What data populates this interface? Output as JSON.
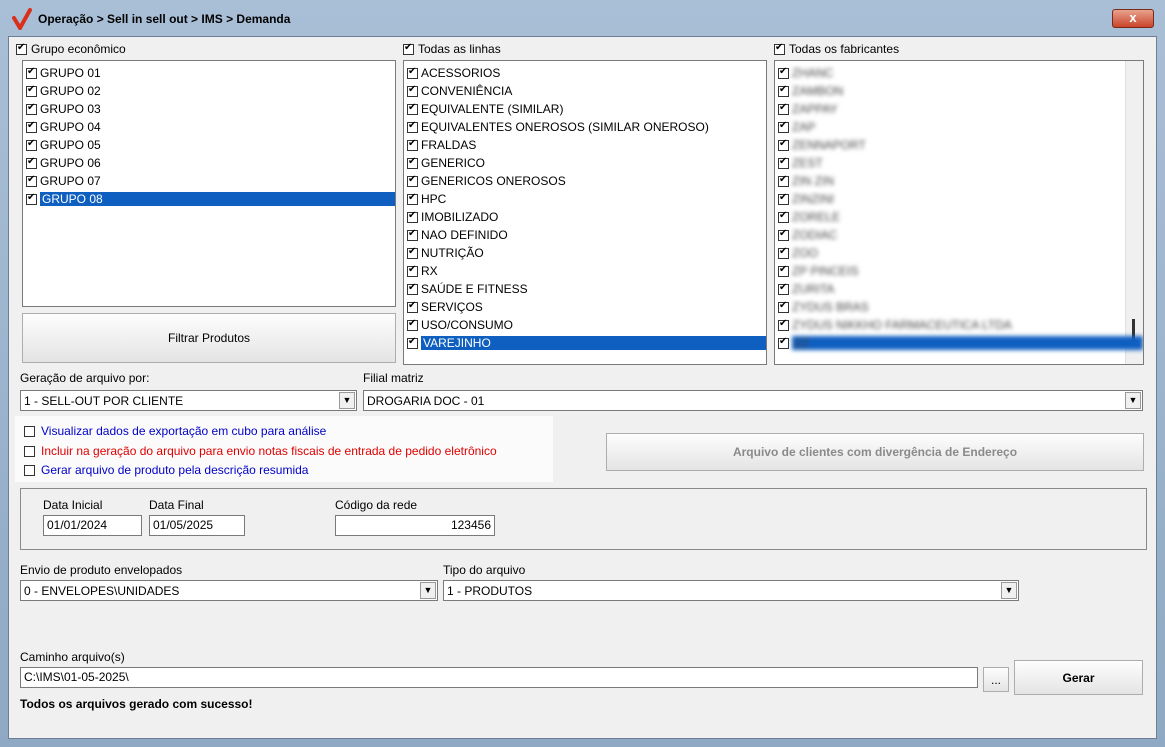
{
  "window": {
    "title": "Operação > Sell in sell out > IMS > Demanda",
    "close": "x"
  },
  "groups": {
    "header": "Grupo econômico",
    "items": [
      {
        "label": "GRUPO 01",
        "checked": true
      },
      {
        "label": "GRUPO 02",
        "checked": true
      },
      {
        "label": "GRUPO 03",
        "checked": true
      },
      {
        "label": "GRUPO 04",
        "checked": true
      },
      {
        "label": "GRUPO 05",
        "checked": true
      },
      {
        "label": "GRUPO 06",
        "checked": true
      },
      {
        "label": "GRUPO 07",
        "checked": true
      },
      {
        "label": "GRUPO 08",
        "checked": true,
        "selected": true
      }
    ]
  },
  "lines": {
    "header": "Todas as linhas",
    "items": [
      {
        "label": "ACESSORIOS",
        "checked": true
      },
      {
        "label": "CONVENIÊNCIA",
        "checked": true
      },
      {
        "label": "EQUIVALENTE (SIMILAR)",
        "checked": true
      },
      {
        "label": "EQUIVALENTES ONEROSOS (SIMILAR ONEROSO)",
        "checked": true
      },
      {
        "label": "FRALDAS",
        "checked": true
      },
      {
        "label": "GENERICO",
        "checked": true
      },
      {
        "label": "GENERICOS ONEROSOS",
        "checked": true
      },
      {
        "label": "HPC",
        "checked": true
      },
      {
        "label": "IMOBILIZADO",
        "checked": true
      },
      {
        "label": "NAO DEFINIDO",
        "checked": true
      },
      {
        "label": "NUTRIÇÃO",
        "checked": true
      },
      {
        "label": "RX",
        "checked": true
      },
      {
        "label": "SAÚDE E FITNESS",
        "checked": true
      },
      {
        "label": "SERVIÇOS",
        "checked": true
      },
      {
        "label": "USO/CONSUMO",
        "checked": true
      },
      {
        "label": "VAREJINHO",
        "checked": true,
        "selected": true
      }
    ]
  },
  "manufacturers": {
    "header": "Todas os fabricantes",
    "items": [
      {
        "label": "ZHANC",
        "checked": true
      },
      {
        "label": "ZAMBON",
        "checked": true
      },
      {
        "label": "ZAPPAY",
        "checked": true
      },
      {
        "label": "ZAP",
        "checked": true
      },
      {
        "label": "ZENNAPORT",
        "checked": true
      },
      {
        "label": "ZEST",
        "checked": true
      },
      {
        "label": "ZIN ZIN",
        "checked": true
      },
      {
        "label": "ZINZINI",
        "checked": true
      },
      {
        "label": "ZORELE",
        "checked": true
      },
      {
        "label": "ZODIAC",
        "checked": true
      },
      {
        "label": "ZOO",
        "checked": true
      },
      {
        "label": "ZP PINCEIS",
        "checked": true
      },
      {
        "label": "ZURITA",
        "checked": true
      },
      {
        "label": "ZYDUS BRAS",
        "checked": true
      },
      {
        "label": "ZYDUS NIKKHO FARMACEUTICA LTDA",
        "checked": true
      },
      {
        "label": "ZZ",
        "checked": true,
        "selected": true
      }
    ]
  },
  "filter_button": "Filtrar Produtos",
  "generation": {
    "label": "Geração de arquivo por:",
    "value": "1 - SELL-OUT POR CLIENTE"
  },
  "branch": {
    "label": "Filial matriz",
    "value": "DROGARIA DOC - 01"
  },
  "options": [
    {
      "label": "Visualizar dados de exportação em cubo para análise",
      "color": "#0000c8",
      "checked": false
    },
    {
      "label": "Incluir na geração do arquivo para envio notas fiscais de entrada de pedido eletrônico",
      "color": "#e00000",
      "checked": false
    },
    {
      "label": "Gerar arquivo de produto pela descrição resumida",
      "color": "#0000c8",
      "checked": false
    }
  ],
  "divergence_button": "Arquivo de clientes com divergência de Endereço",
  "dates": {
    "start_label": "Data Inicial",
    "start": "01/01/2024",
    "end_label": "Data Final",
    "end": "01/05/2025",
    "network_label": "Código da rede",
    "network": "123456"
  },
  "envelope": {
    "label": "Envio de produto envelopados",
    "value": "0 - ENVELOPES\\UNIDADES"
  },
  "file_type": {
    "label": "Tipo do arquivo",
    "value": "1 - PRODUTOS"
  },
  "path": {
    "label": "Caminho arquivo(s)",
    "value": "C:\\IMS\\01-05-2025\\",
    "browse": "...",
    "generate": "Gerar"
  },
  "status": "Todos os arquivos gerado com sucesso!"
}
